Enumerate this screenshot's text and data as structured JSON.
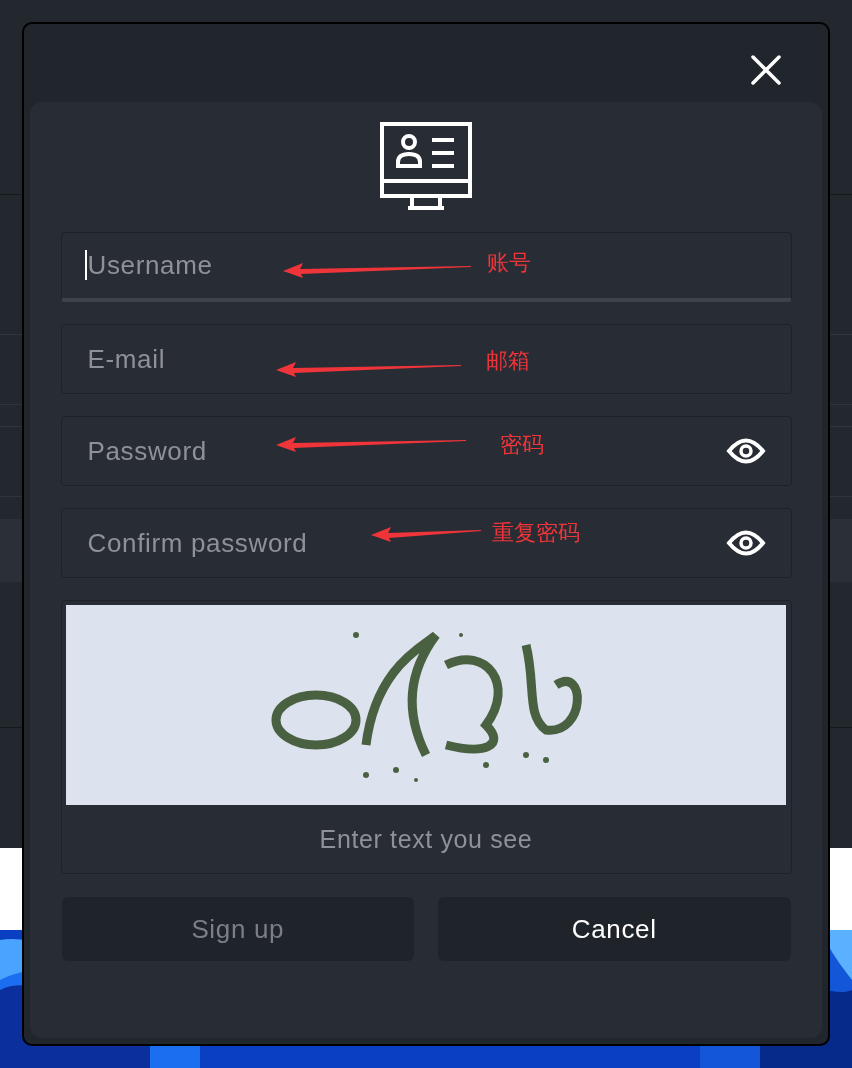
{
  "dialog": {
    "fields": [
      {
        "kind": "text",
        "placeholder": "Username",
        "focused": true,
        "annotation": "账号"
      },
      {
        "kind": "text",
        "placeholder": "E-mail",
        "focused": false,
        "annotation": "邮箱"
      },
      {
        "kind": "password",
        "placeholder": "Password",
        "focused": false,
        "annotation": "密码"
      },
      {
        "kind": "password",
        "placeholder": "Confirm password",
        "focused": false,
        "annotation": "重复密码"
      }
    ],
    "captcha": {
      "placeholder": "Enter text you see"
    },
    "buttons": [
      {
        "label": "Sign up",
        "disabled": true
      },
      {
        "label": "Cancel",
        "disabled": false
      }
    ]
  }
}
